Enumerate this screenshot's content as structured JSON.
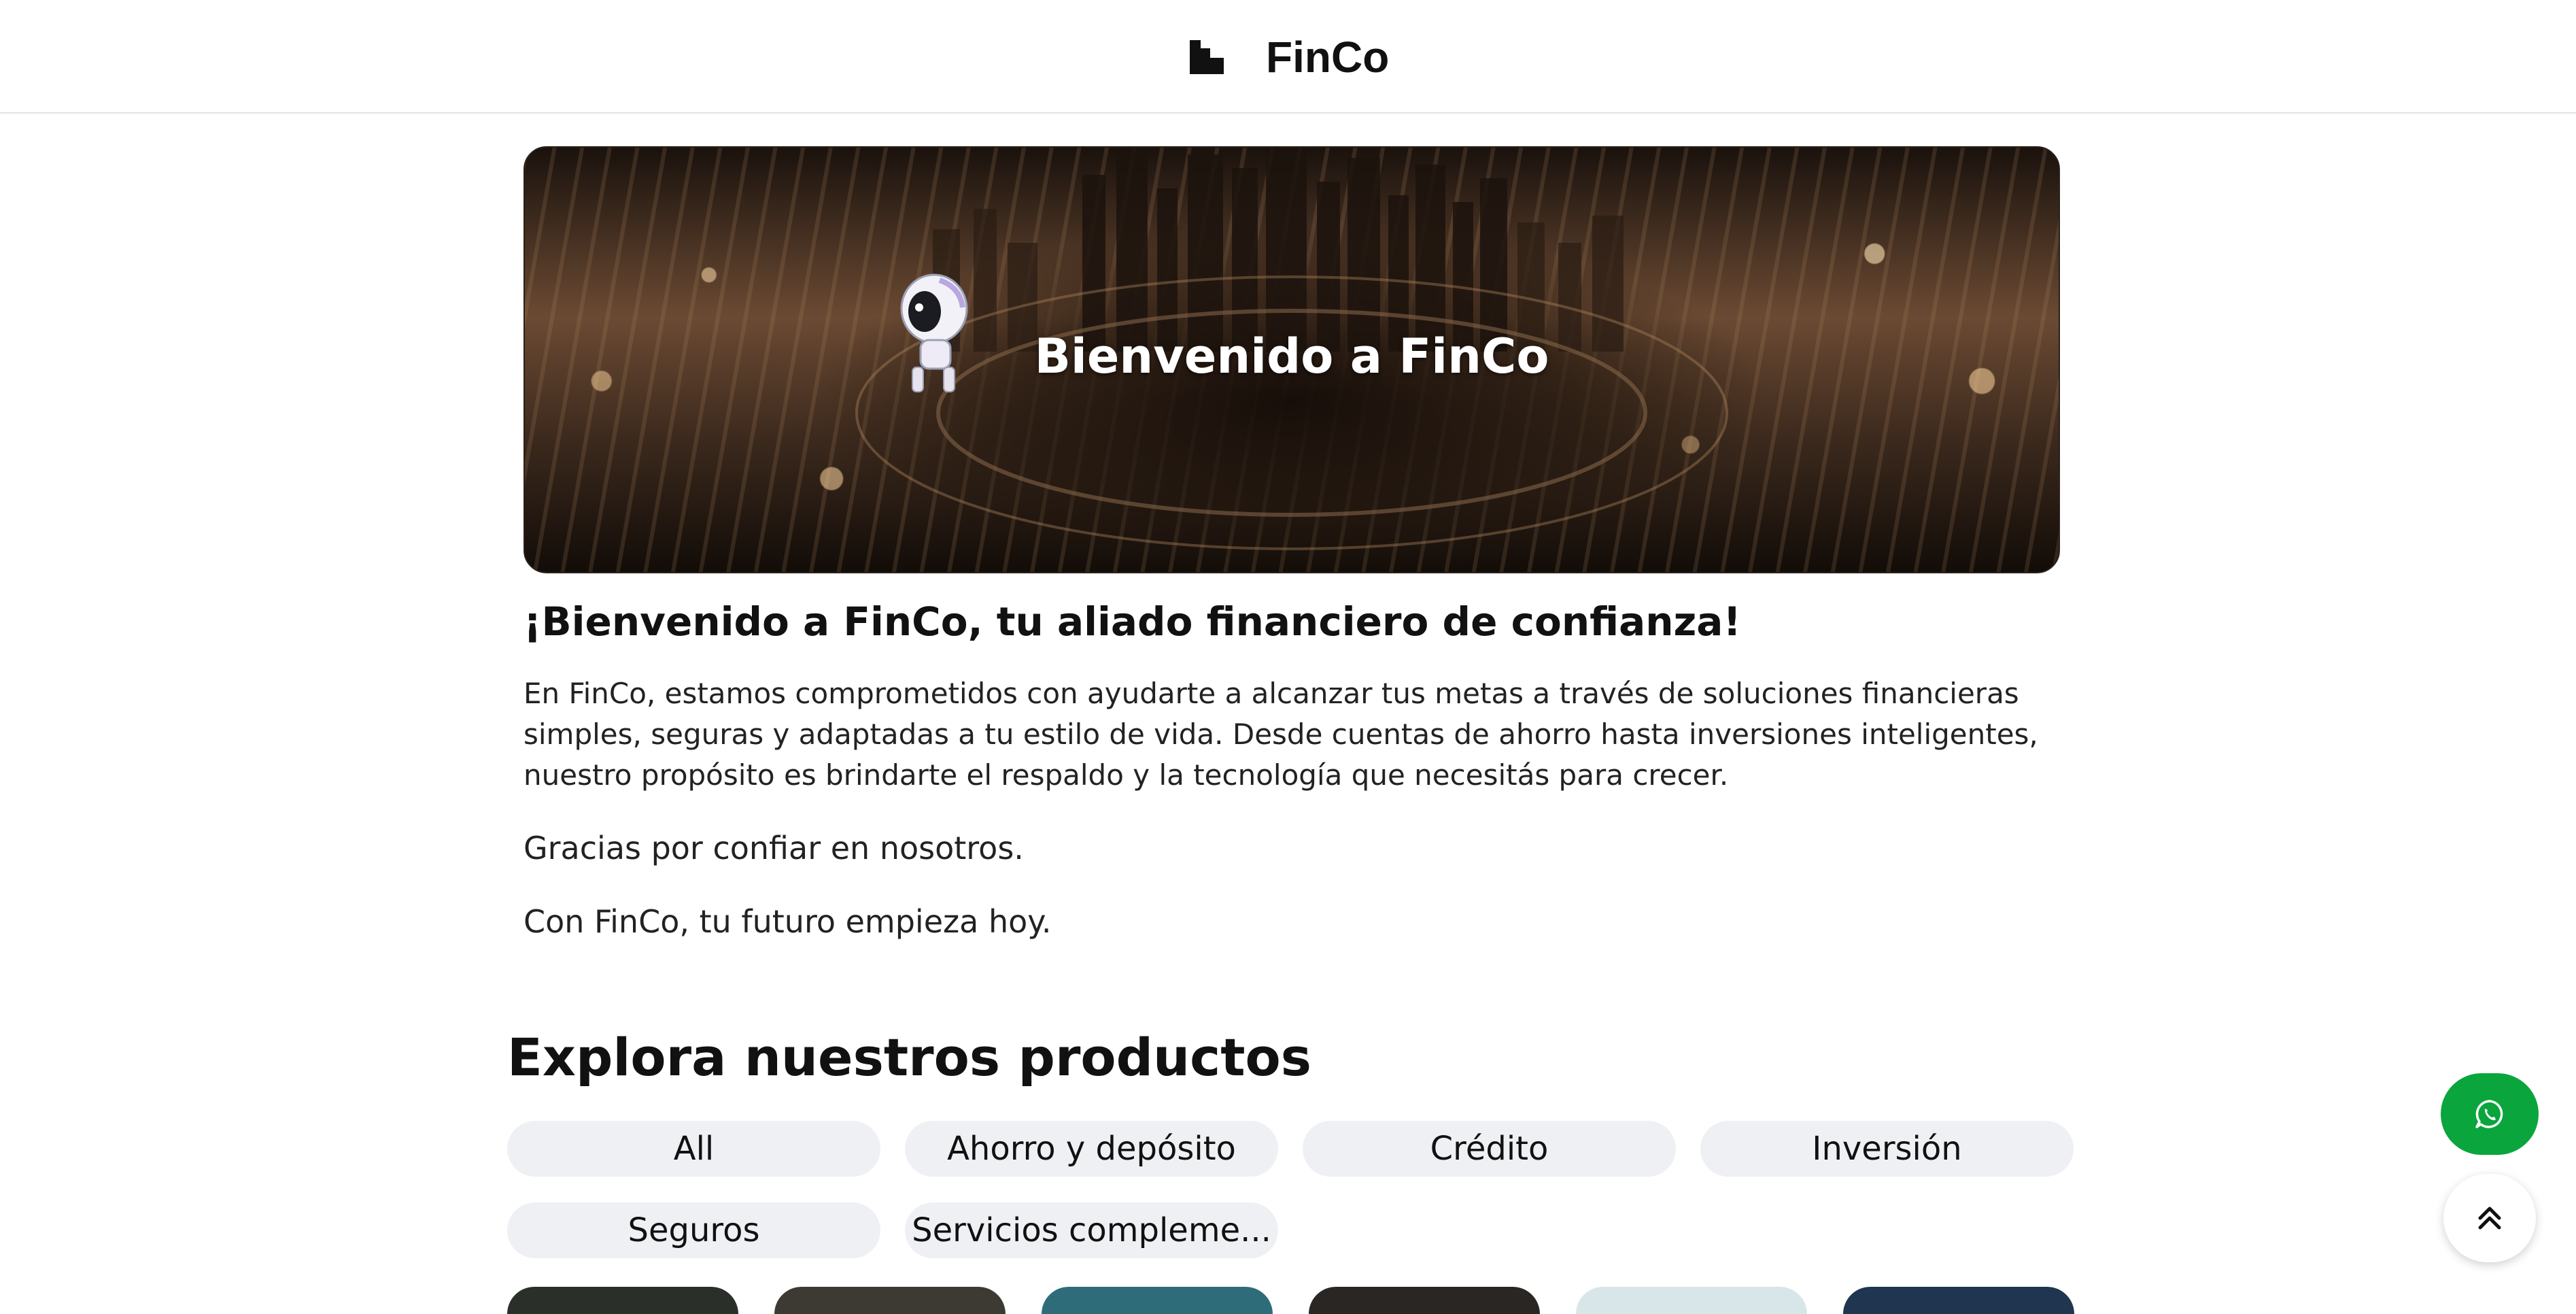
{
  "header": {
    "brand_name": "FinCo",
    "logo_icon": "finco-logo-icon"
  },
  "hero": {
    "title": "Bienvenido a FinCo",
    "mascot_icon": "robot-mascot-icon"
  },
  "intro": {
    "heading": "¡Bienvenido a FinCo, tu aliado financiero de confianza!",
    "paragraph": "En FinCo, estamos comprometidos con ayudarte a alcanzar tus metas a través de soluciones financieras simples, seguras y adaptadas a tu estilo de vida. Desde cuentas de ahorro hasta inversiones inteligentes, nuestro propósito es brindarte el respaldo y la tecnología que necesitás para crecer.",
    "thanks": "Gracias por confiar en nosotros.",
    "closing": "Con FinCo, tu futuro empieza hoy."
  },
  "products": {
    "title": "Explora nuestros productos",
    "filters": [
      "All",
      "Ahorro y depósito",
      "Crédito",
      "Inversión",
      "Seguros",
      "Servicios compleme..."
    ]
  },
  "floating": {
    "whatsapp_icon": "whatsapp-icon",
    "scroll_top_icon": "double-chevron-up-icon"
  },
  "colors": {
    "accent_green": "#0aa53c",
    "pill_bg": "#eff0f3",
    "text": "#111111"
  }
}
